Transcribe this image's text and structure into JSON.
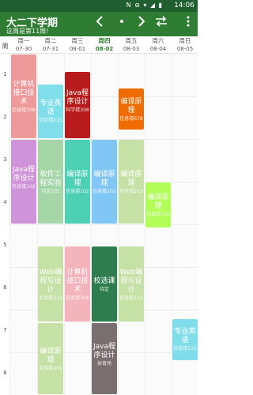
{
  "status_bar": {
    "indicators": "N ⊖ ▾ ◢ ▮",
    "time": "14:06"
  },
  "app_bar": {
    "title": "大二下学期",
    "subtitle": "这周是第11周!",
    "prev_icon": "chevron-left-icon",
    "center_icon": "dot-icon",
    "next_icon": "chevron-right-icon",
    "add_icon": "plus-icon",
    "swap_icon": "swap-icon",
    "more_icon": "more-vert-icon"
  },
  "week_header": {
    "corner_label": "周",
    "days": [
      {
        "name": "周一",
        "date": "07-30"
      },
      {
        "name": "周二",
        "date": "07-31"
      },
      {
        "name": "周三",
        "date": "08-01"
      },
      {
        "name": "周四",
        "date": "08-02"
      },
      {
        "name": "周五",
        "date": "08-03"
      },
      {
        "name": "周六",
        "date": "08-04"
      },
      {
        "name": "周日",
        "date": "08-05"
      }
    ],
    "today_index": 3
  },
  "periods": [
    "1",
    "2",
    "3",
    "4",
    "5",
    "6",
    "7",
    "8"
  ],
  "courses": [
    {
      "name": "计算机接口技术",
      "room": "信息楼308",
      "day": 0,
      "start": 0,
      "span": 2,
      "color": "#ef9a9a",
      "dark": false
    },
    {
      "name": "专业英语",
      "room": "信息楼215",
      "day": 1,
      "start": 0.7,
      "span": 1.3,
      "color": "#80deea",
      "dark": false
    },
    {
      "name": "Java程序设计",
      "room": "科学楼308",
      "day": 2,
      "start": 0.4,
      "span": 1.6,
      "color": "#b71c1c",
      "dark": false
    },
    {
      "name": "编译原理",
      "room": "信息楼678",
      "day": 4,
      "start": 0.8,
      "span": 1.0,
      "color": "#ef6c00",
      "dark": false
    },
    {
      "name": "Java程序设计",
      "room": "信息楼102",
      "day": 0,
      "start": 2,
      "span": 2,
      "color": "#ce93d8",
      "dark": false
    },
    {
      "name": "软件工程实验",
      "room": "待定205",
      "day": 1,
      "start": 2,
      "span": 2,
      "color": "#a5d6a7",
      "dark": false
    },
    {
      "name": "编译原理",
      "room": "信息楼102",
      "day": 2,
      "start": 2,
      "span": 2,
      "color": "#4dd0b4",
      "dark": false
    },
    {
      "name": "编译原理",
      "room": "信息楼102",
      "day": 3,
      "start": 2,
      "span": 2,
      "color": "#81c7f5",
      "dark": false
    },
    {
      "name": "编译原理",
      "room": "思考楼212",
      "day": 4,
      "start": 2,
      "span": 2,
      "color": "#c5e1a5",
      "dark": false
    },
    {
      "name": "编译原理",
      "room": "信息楼102",
      "day": 5,
      "start": 3,
      "span": 1.1,
      "color": "#b2ff59",
      "dark": false
    },
    {
      "name": "Web编程与设计",
      "room": "实验楼319",
      "day": 1,
      "start": 4.5,
      "span": 1.8,
      "color": "#c5e1a5",
      "dark": false
    },
    {
      "name": "计算机接口技术",
      "room": "信息楼308",
      "day": 2,
      "start": 4.5,
      "span": 1.8,
      "color": "#f4b4bb",
      "dark": false
    },
    {
      "name": "校选课",
      "room": "待定",
      "day": 3,
      "start": 4.5,
      "span": 1.8,
      "color": "#2e7d4f",
      "dark": false
    },
    {
      "name": "Web编程与设计",
      "room": "信息楼102",
      "day": 4,
      "start": 4.5,
      "span": 1.8,
      "color": "#c5e1a5",
      "dark": false
    },
    {
      "name": "专业英语",
      "room": "信息楼215",
      "day": 6,
      "start": 6.2,
      "span": 1.0,
      "color": "#80deea",
      "dark": false
    },
    {
      "name": "编译原理",
      "room": "实验楼305",
      "day": 1,
      "start": 6.3,
      "span": 1.7,
      "color": "#c5e1a5",
      "dark": false
    },
    {
      "name": "Java程序设计",
      "room": "体育场",
      "day": 3,
      "start": 6.3,
      "span": 1.7,
      "color": "#7a6f6f",
      "dark": false
    }
  ]
}
